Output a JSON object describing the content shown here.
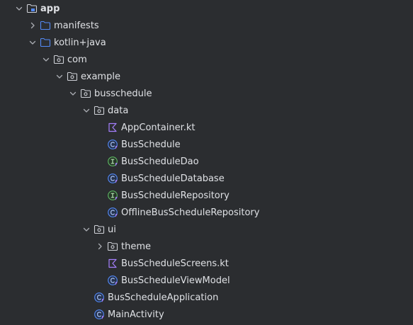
{
  "tree": [
    {
      "label": "app",
      "depth": 0,
      "expander": "expanded",
      "icon": "module-folder-icon",
      "bold": true
    },
    {
      "label": "manifests",
      "depth": 1,
      "expander": "collapsed",
      "icon": "folder-icon"
    },
    {
      "label": "kotlin+java",
      "depth": 1,
      "expander": "expanded",
      "icon": "folder-icon"
    },
    {
      "label": "com",
      "depth": 2,
      "expander": "expanded",
      "icon": "package-icon"
    },
    {
      "label": "example",
      "depth": 3,
      "expander": "expanded",
      "icon": "package-icon"
    },
    {
      "label": "busschedule",
      "depth": 4,
      "expander": "expanded",
      "icon": "package-icon"
    },
    {
      "label": "data",
      "depth": 5,
      "expander": "expanded",
      "icon": "package-icon"
    },
    {
      "label": "AppContainer.kt",
      "depth": 6,
      "expander": "none",
      "icon": "kotlin-file-icon"
    },
    {
      "label": "BusSchedule",
      "depth": 6,
      "expander": "none",
      "icon": "kotlin-class-icon"
    },
    {
      "label": "BusScheduleDao",
      "depth": 6,
      "expander": "none",
      "icon": "kotlin-interface-icon"
    },
    {
      "label": "BusScheduleDatabase",
      "depth": 6,
      "expander": "none",
      "icon": "kotlin-class-icon"
    },
    {
      "label": "BusScheduleRepository",
      "depth": 6,
      "expander": "none",
      "icon": "kotlin-interface-icon"
    },
    {
      "label": "OfflineBusScheduleRepository",
      "depth": 6,
      "expander": "none",
      "icon": "kotlin-class-icon"
    },
    {
      "label": "ui",
      "depth": 5,
      "expander": "expanded",
      "icon": "package-icon"
    },
    {
      "label": "theme",
      "depth": 6,
      "expander": "collapsed",
      "icon": "package-icon"
    },
    {
      "label": "BusScheduleScreens.kt",
      "depth": 6,
      "expander": "none",
      "icon": "kotlin-file-icon"
    },
    {
      "label": "BusScheduleViewModel",
      "depth": 6,
      "expander": "none",
      "icon": "kotlin-class-icon"
    },
    {
      "label": "BusScheduleApplication",
      "depth": 5,
      "expander": "none",
      "icon": "kotlin-class-icon"
    },
    {
      "label": "MainActivity",
      "depth": 5,
      "expander": "none",
      "icon": "kotlin-class-icon"
    }
  ],
  "colors": {
    "background": "#2b2d30",
    "text": "#dfe1e5",
    "chevron": "#a9acb2",
    "folder_stroke": "#548af7",
    "package_stroke": "#ced0d6",
    "kotlin_purple": "#a57ffd",
    "class_stroke": "#548af7",
    "interface_stroke": "#5fb865",
    "class_letter": "#a9c2f4",
    "interface_letter": "#b3e3b0",
    "class_fill": "#25324d",
    "interface_fill": "#253627"
  }
}
